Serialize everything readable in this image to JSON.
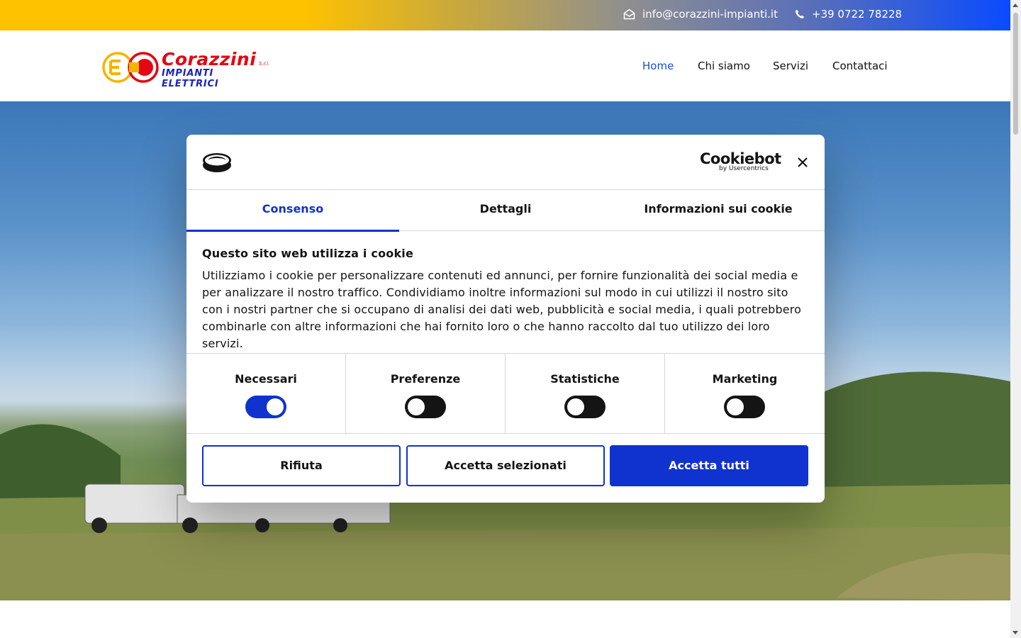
{
  "topbar": {
    "email": "info@corazzini-impianti.it",
    "phone": "+39 0722 78228",
    "email_icon": "envelope-open-icon",
    "phone_icon": "phone-icon"
  },
  "header": {
    "logo": {
      "brand": "Corazzini",
      "suffix": "S.r.l.",
      "subtitle": "IMPIANTI ELETTRICI"
    },
    "nav": [
      {
        "label": "Home",
        "active": true
      },
      {
        "label": "Chi siamo",
        "active": false
      },
      {
        "label": "Servizi",
        "active": false
      },
      {
        "label": "Contattaci",
        "active": false
      }
    ]
  },
  "cookie_dialog": {
    "brand": "Cookiebot",
    "brand_by": "by Usercentrics",
    "tabs": [
      {
        "label": "Consenso",
        "active": true
      },
      {
        "label": "Dettagli",
        "active": false
      },
      {
        "label": "Informazioni sui cookie",
        "active": false
      }
    ],
    "heading": "Questo sito web utilizza i cookie",
    "body": "Utilizziamo i cookie per personalizzare contenuti ed annunci, per fornire funzionalità dei social media e per analizzare il nostro traffico. Condividiamo inoltre informazioni sul modo in cui utilizzi il nostro sito con i nostri partner che si occupano di analisi dei dati web, pubblicità e social media, i quali potrebbero combinarle con altre informazioni che hai fornito loro o che hanno raccolto dal tuo utilizzo dei loro servizi.",
    "categories": [
      {
        "label": "Necessari",
        "enabled": true
      },
      {
        "label": "Preferenze",
        "enabled": false
      },
      {
        "label": "Statistiche",
        "enabled": false
      },
      {
        "label": "Marketing",
        "enabled": false
      }
    ],
    "buttons": {
      "reject": "Rifiuta",
      "accept_selected": "Accetta selezionati",
      "accept_all": "Accetta tutti"
    },
    "colors": {
      "accent": "#1032cf"
    }
  }
}
